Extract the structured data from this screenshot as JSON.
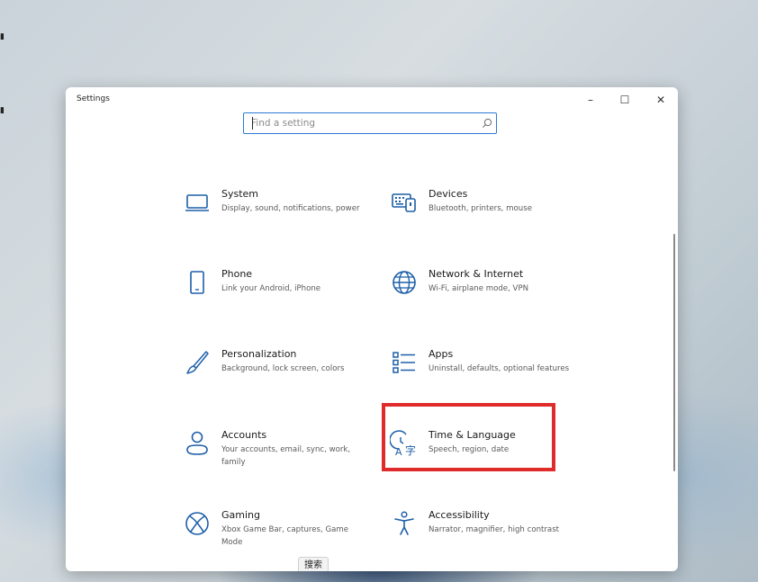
{
  "window": {
    "title": "Settings",
    "controls": {
      "minimize": "–",
      "maximize": "☐",
      "close": "✕"
    }
  },
  "search": {
    "placeholder": "Find a setting",
    "value": ""
  },
  "categories": [
    {
      "name": "System",
      "desc": "Display, sound, notifications, power",
      "icon": "monitor-icon"
    },
    {
      "name": "Devices",
      "desc": "Bluetooth, printers, mouse",
      "icon": "keyboard-icon"
    },
    {
      "name": "Phone",
      "desc": "Link your Android, iPhone",
      "icon": "phone-icon"
    },
    {
      "name": "Network & Internet",
      "desc": "Wi-Fi, airplane mode, VPN",
      "icon": "globe-icon"
    },
    {
      "name": "Personalization",
      "desc": "Background, lock screen, colors",
      "icon": "brush-icon"
    },
    {
      "name": "Apps",
      "desc": "Uninstall, defaults, optional features",
      "icon": "apps-list-icon"
    },
    {
      "name": "Accounts",
      "desc": "Your accounts, email, sync, work, family",
      "icon": "person-icon"
    },
    {
      "name": "Time & Language",
      "desc": "Speech, region, date",
      "icon": "time-language-icon"
    },
    {
      "name": "Gaming",
      "desc": "Xbox Game Bar, captures, Game Mode",
      "icon": "xbox-icon"
    },
    {
      "name": "Accessibility",
      "desc": "Narrator, magnifier, high contrast",
      "icon": "accessibility-icon"
    }
  ],
  "tooltip": "搜索",
  "colors": {
    "accent": "#2b7bd4",
    "icon": "#1d5fa8",
    "highlight": "#e02b2b"
  }
}
